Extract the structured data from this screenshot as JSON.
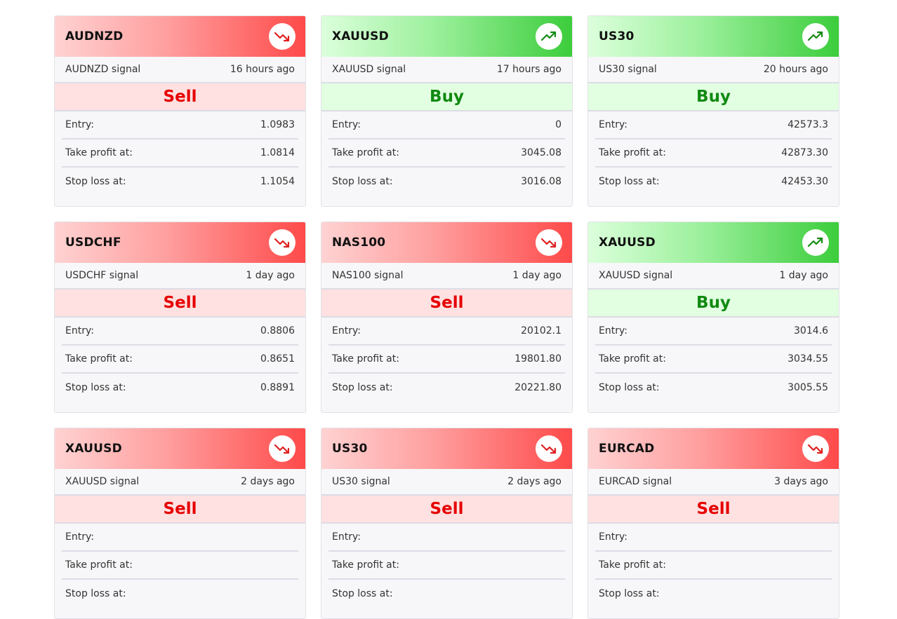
{
  "colors": {
    "sell": "#e60000",
    "buy": "#108a10",
    "sell_header": "#ff4a4a",
    "buy_header": "#3ccd3c"
  },
  "labels": {
    "entry": "Entry:",
    "take_profit": "Take profit at:",
    "stop_loss": "Stop loss at:"
  },
  "signals": [
    {
      "symbol": "AUDNZD",
      "subtitle": "AUDNZD signal",
      "time": "16 hours ago",
      "action": "Sell",
      "direction": "down",
      "icon": "trend-down-icon",
      "entry": "1.0983",
      "take_profit": "1.0814",
      "stop_loss": "1.1054"
    },
    {
      "symbol": "XAUUSD",
      "subtitle": "XAUUSD signal",
      "time": "17 hours ago",
      "action": "Buy",
      "direction": "up",
      "icon": "trend-up-icon",
      "entry": "0",
      "take_profit": "3045.08",
      "stop_loss": "3016.08"
    },
    {
      "symbol": "US30",
      "subtitle": "US30 signal",
      "time": "20 hours ago",
      "action": "Buy",
      "direction": "up",
      "icon": "trend-up-icon",
      "entry": "42573.3",
      "take_profit": "42873.30",
      "stop_loss": "42453.30"
    },
    {
      "symbol": "USDCHF",
      "subtitle": "USDCHF signal",
      "time": "1 day ago",
      "action": "Sell",
      "direction": "down",
      "icon": "trend-down-icon",
      "entry": "0.8806",
      "take_profit": "0.8651",
      "stop_loss": "0.8891"
    },
    {
      "symbol": "NAS100",
      "subtitle": "NAS100 signal",
      "time": "1 day ago",
      "action": "Sell",
      "direction": "down",
      "icon": "trend-down-icon",
      "entry": "20102.1",
      "take_profit": "19801.80",
      "stop_loss": "20221.80"
    },
    {
      "symbol": "XAUUSD",
      "subtitle": "XAUUSD signal",
      "time": "1 day ago",
      "action": "Buy",
      "direction": "up",
      "icon": "trend-up-icon",
      "entry": "3014.6",
      "take_profit": "3034.55",
      "stop_loss": "3005.55"
    },
    {
      "symbol": "XAUUSD",
      "subtitle": "XAUUSD signal",
      "time": "2 days ago",
      "action": "Sell",
      "direction": "down",
      "icon": "trend-down-icon",
      "entry": "",
      "take_profit": "",
      "stop_loss": ""
    },
    {
      "symbol": "US30",
      "subtitle": "US30 signal",
      "time": "2 days ago",
      "action": "Sell",
      "direction": "down",
      "icon": "trend-down-icon",
      "entry": "",
      "take_profit": "",
      "stop_loss": ""
    },
    {
      "symbol": "EURCAD",
      "subtitle": "EURCAD signal",
      "time": "3 days ago",
      "action": "Sell",
      "direction": "down",
      "icon": "trend-down-icon",
      "entry": "",
      "take_profit": "",
      "stop_loss": ""
    }
  ]
}
